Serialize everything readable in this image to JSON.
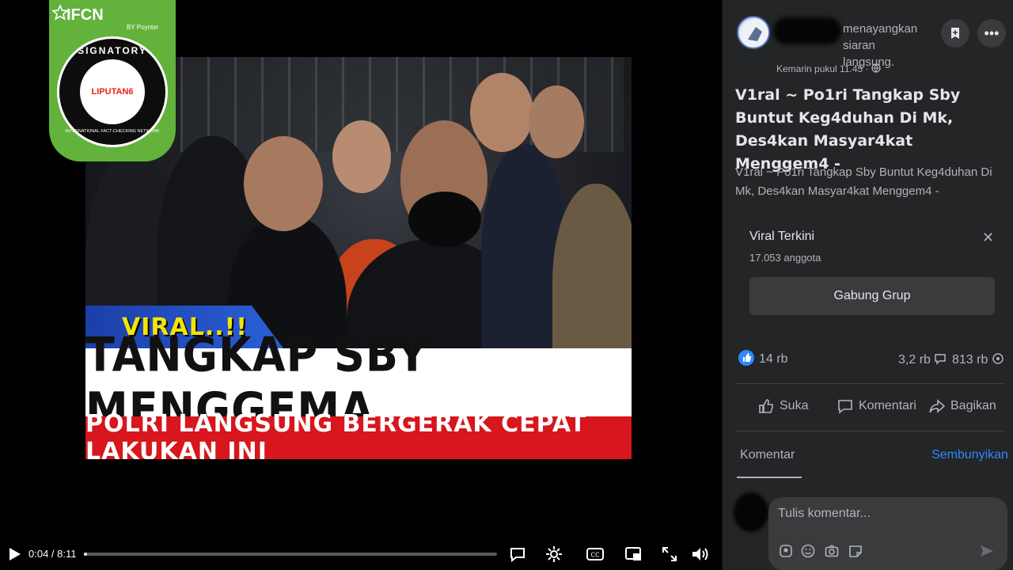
{
  "video": {
    "overlay_tag": "VIRAL..!!",
    "headline_main": "TANGKAP SBY MENGGEMA",
    "headline_sub": "POLRI LANGSUNG BERGERAK CEPAT LAKUKAN INI",
    "badge": {
      "title": "IFCN",
      "by": "BY Poynter",
      "ring_text": "SIGNATORY",
      "ring_bottom": "INTERNATIONAL FACT-CHECKING NETWORK",
      "logo_text": "LIPUTAN6"
    },
    "controls": {
      "time": "0:04 / 8:11",
      "progress_fraction": 0.008,
      "icons": [
        "play-icon",
        "speech-bubble-icon",
        "gear-icon",
        "cc-icon",
        "picture-in-picture-icon",
        "fullscreen-icon",
        "volume-icon"
      ]
    }
  },
  "post": {
    "action_text": "menayangkan siaran langsung.",
    "timestamp": "Kemarin pukul 11.45 · ",
    "title": "V1ral ~ Po1ri Tangkap Sby Buntut Keg4duhan Di Mk, Des4kan Masyar4kat Menggem4 -",
    "description": "V1ral ~ Po1ri Tangkap Sby Buntut Keg4duhan Di Mk, Des4kan Masyar4kat Menggem4 -",
    "group": {
      "name": "Viral Terkini",
      "members": "17.053 anggota",
      "join_label": "Gabung Grup"
    },
    "stats": {
      "likes": "14 rb",
      "comments": "3,2 rb",
      "shares": "813 rb"
    },
    "actions": {
      "like": "Suka",
      "comment": "Komentari",
      "share": "Bagikan"
    },
    "comments": {
      "tab_label": "Komentar",
      "hide_label": "Sembunyikan",
      "placeholder": "Tulis komentar..."
    }
  },
  "colors": {
    "panel_bg": "#242526",
    "accent_blue": "#2d88ff",
    "ifcn_green": "#62b23c",
    "headline_red": "#d7161d",
    "tag_yellow": "#f4e400"
  }
}
